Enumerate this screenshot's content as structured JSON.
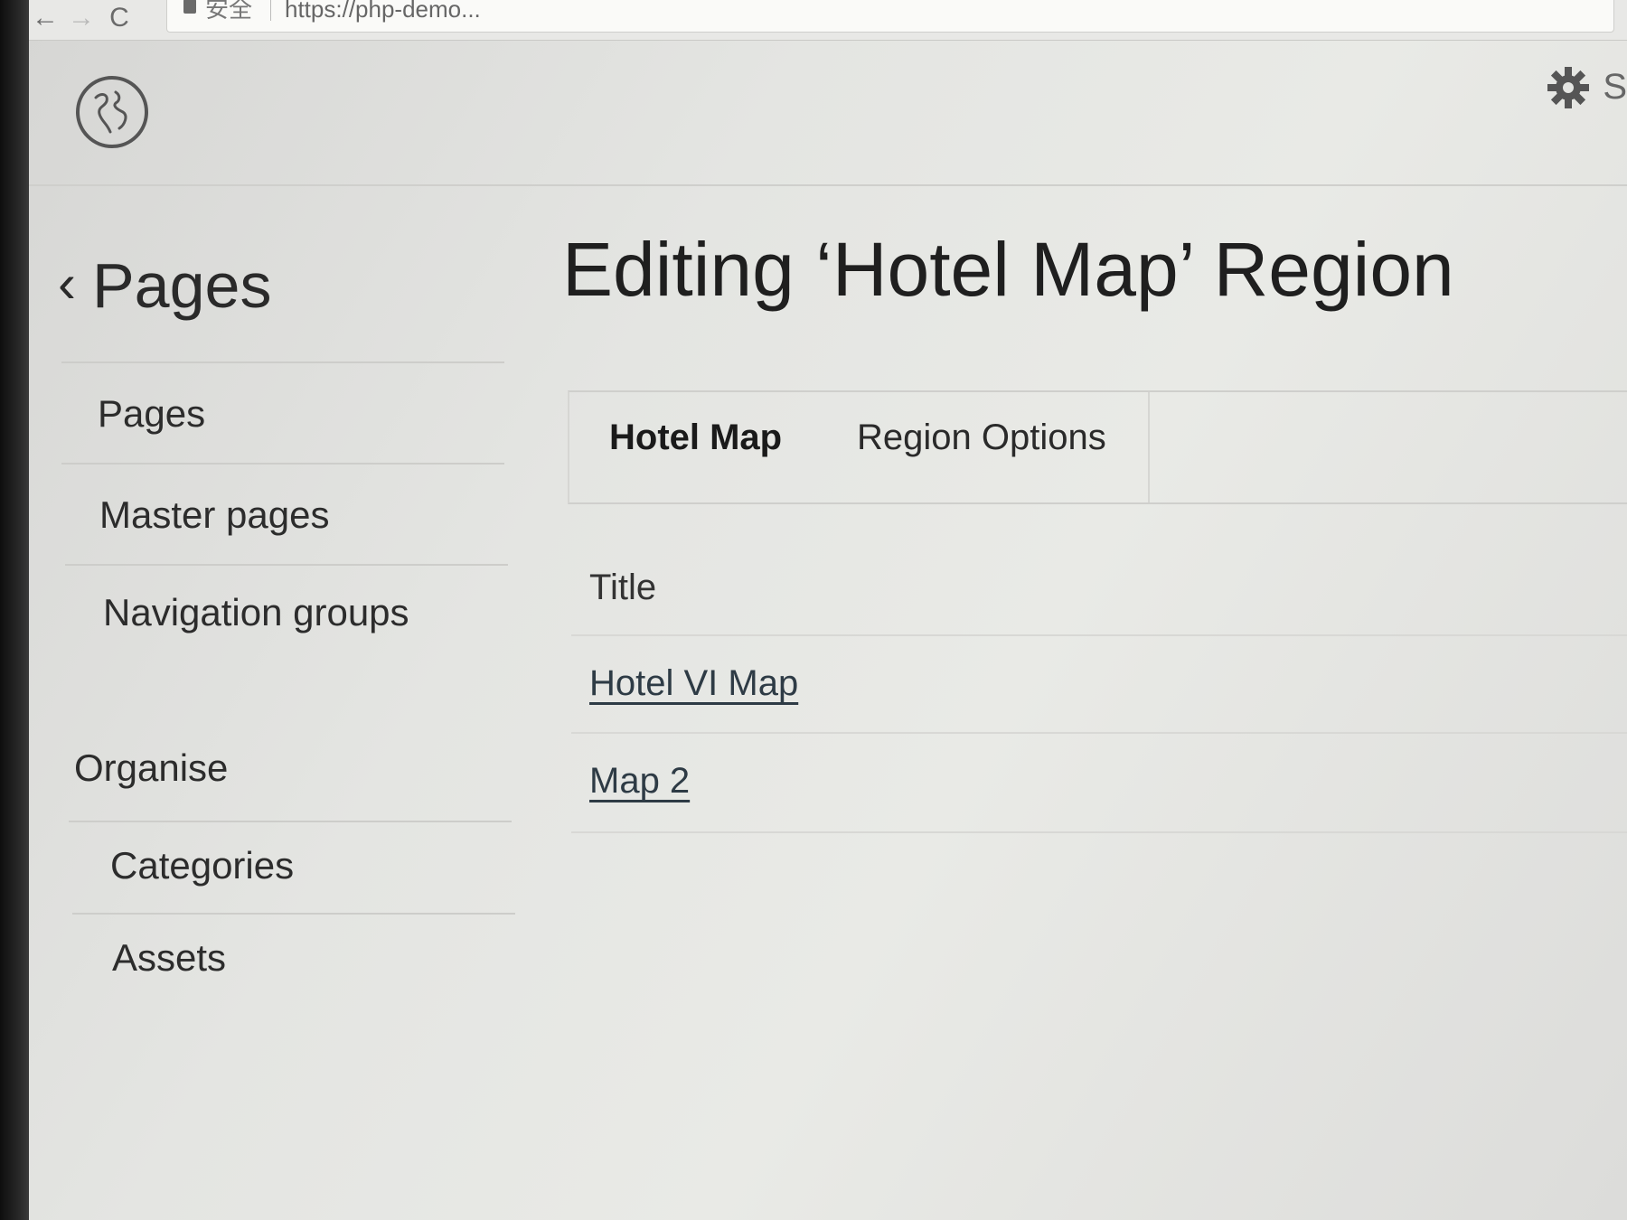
{
  "browser": {
    "back_icon": "arrow-left-icon",
    "forward_icon": "arrow-right-icon",
    "reload_icon": "reload-icon",
    "back_glyph": "←",
    "forward_glyph": "→",
    "reload_glyph": "C",
    "secure_label": "安全",
    "url": "https://php-demo..."
  },
  "header": {
    "logo_icon": "globe-icon",
    "settings_icon": "gear-icon",
    "settings_partial_text": "S"
  },
  "sidebar": {
    "back_label": "Pages",
    "back_glyph": "‹",
    "items": [
      {
        "label": "Pages"
      },
      {
        "label": "Master pages"
      },
      {
        "label": "Navigation groups"
      }
    ],
    "section_heading": "Organise",
    "section_items": [
      {
        "label": "Categories"
      },
      {
        "label": "Assets"
      }
    ]
  },
  "main": {
    "title": "Editing ‘Hotel Map’ Region",
    "tabs": [
      {
        "label": "Hotel Map",
        "active": true
      },
      {
        "label": "Region Options",
        "active": false
      }
    ],
    "table": {
      "column_header": "Title",
      "rows": [
        {
          "title": "Hotel VI Map"
        },
        {
          "title": "Map 2"
        }
      ]
    }
  },
  "colors": {
    "screen_bg": "#e4e5e2",
    "text": "#2a2a2a",
    "divider": "#cfcfcc"
  }
}
